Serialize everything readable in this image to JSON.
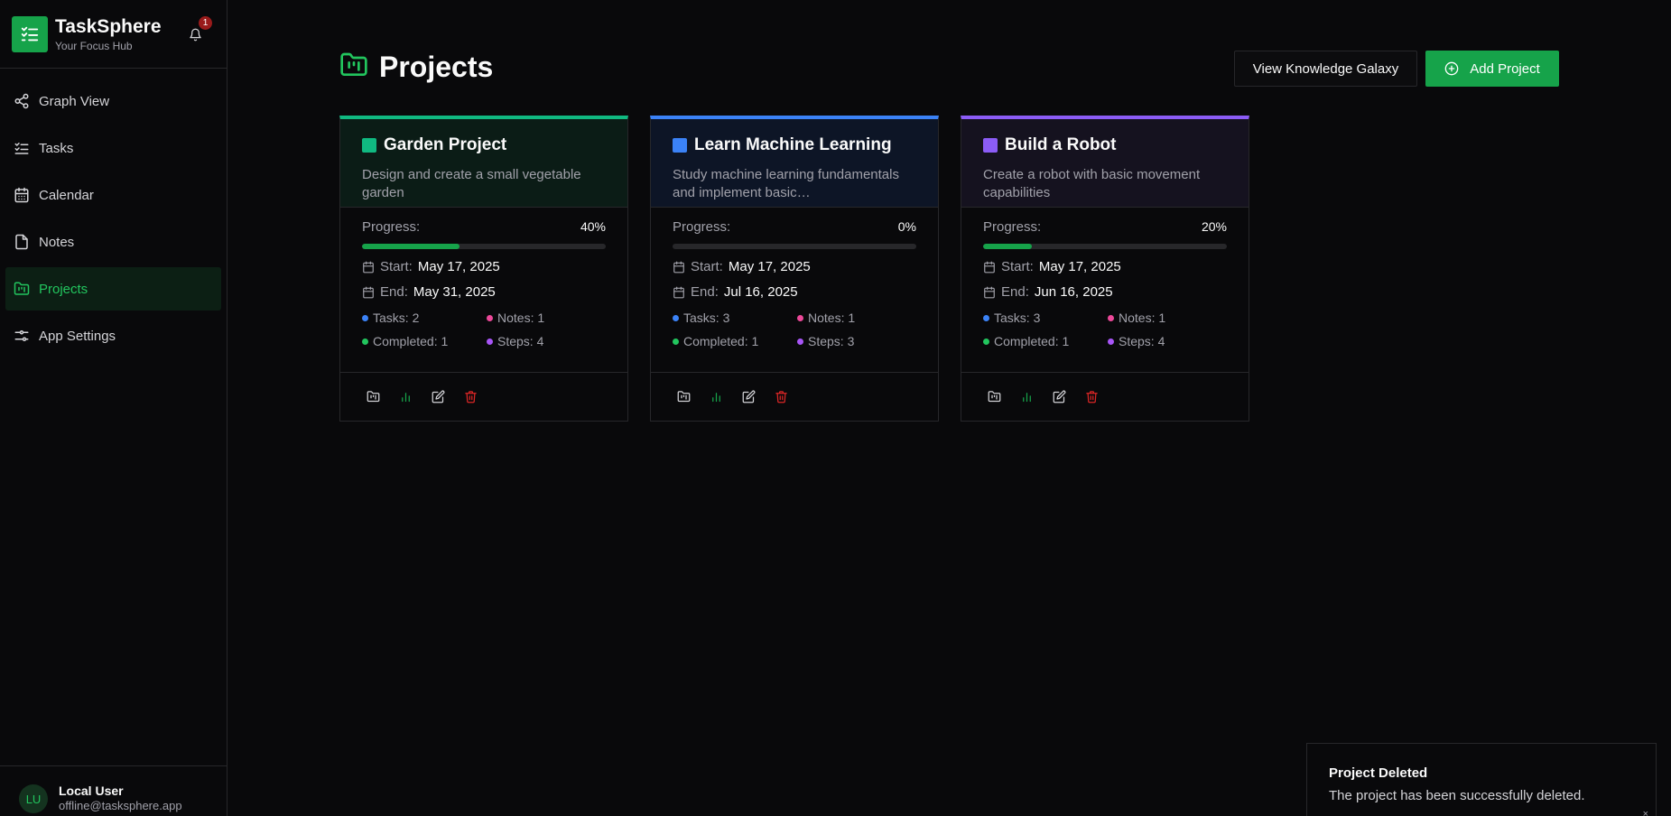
{
  "app": {
    "title": "TaskSphere",
    "subtitle": "Your Focus Hub",
    "notification_count": "1"
  },
  "sidebar": {
    "items": [
      {
        "label": "Graph View",
        "icon": "share-graph-icon"
      },
      {
        "label": "Tasks",
        "icon": "list-checks-icon"
      },
      {
        "label": "Calendar",
        "icon": "calendar-icon"
      },
      {
        "label": "Notes",
        "icon": "file-icon"
      },
      {
        "label": "Projects",
        "icon": "folder-kanban-icon",
        "active": true
      },
      {
        "label": "App Settings",
        "icon": "sliders-icon"
      }
    ]
  },
  "user": {
    "initials": "LU",
    "name": "Local User",
    "email": "offline@tasksphere.app"
  },
  "page": {
    "title": "Projects",
    "view_galaxy_label": "View Knowledge Galaxy",
    "add_project_label": "Add Project"
  },
  "labels": {
    "progress": "Progress:",
    "start": "Start:",
    "end": "End:"
  },
  "projects": [
    {
      "title": "Garden Project",
      "description": "Design and create a small vegetable garden",
      "color": "#10b981",
      "bg": "#0b1c16",
      "progress": 40,
      "progress_text": "40%",
      "start": "May 17, 2025",
      "end": "May 31, 2025",
      "tasks": "Tasks: 2",
      "notes": "Notes: 1",
      "completed": "Completed: 1",
      "steps": "Steps: 4"
    },
    {
      "title": "Learn Machine Learning",
      "description": "Study machine learning fundamentals and implement basic…",
      "color": "#3b82f6",
      "bg": "#0d1526",
      "progress": 0,
      "progress_text": "0%",
      "start": "May 17, 2025",
      "end": "Jul 16, 2025",
      "tasks": "Tasks: 3",
      "notes": "Notes: 1",
      "completed": "Completed: 1",
      "steps": "Steps: 3"
    },
    {
      "title": "Build a Robot",
      "description": "Create a robot with basic movement capabilities",
      "color": "#8b5cf6",
      "bg": "#15121f",
      "progress": 20,
      "progress_text": "20%",
      "start": "May 17, 2025",
      "end": "Jun 16, 2025",
      "tasks": "Tasks: 3",
      "notes": "Notes: 1",
      "completed": "Completed: 1",
      "steps": "Steps: 4"
    }
  ],
  "stat_colors": {
    "tasks": "#3b82f6",
    "notes": "#ec4899",
    "completed": "#22c55e",
    "steps": "#a855f7"
  },
  "toast": {
    "title": "Project Deleted",
    "description": "The project has been successfully deleted.",
    "close": "×"
  }
}
